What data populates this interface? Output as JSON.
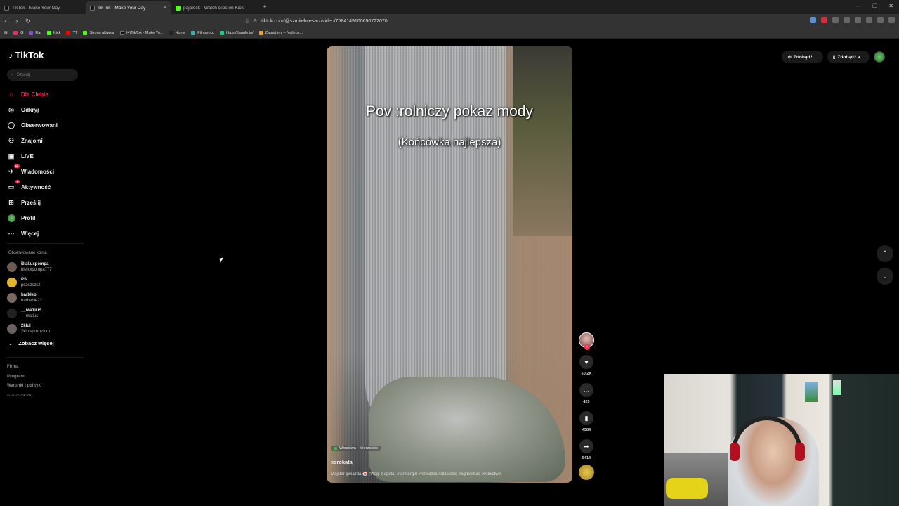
{
  "browser": {
    "tabs": [
      {
        "label": "TikTok - Make Your Day",
        "active": false,
        "icon": "tiktok-icon"
      },
      {
        "label": "TikTok - Make Your Day",
        "active": true,
        "icon": "tiktok-icon"
      },
      {
        "label": "pajalock - Watch clips on Kick",
        "active": false,
        "icon": "kick-icon"
      }
    ],
    "new_tab": "+",
    "url": "tiktok.com/@szmitekcesarz/video/7584149100690722070",
    "bookmarks": [
      "IG",
      "Rat",
      "Kick",
      "YT",
      "Strona główna",
      "(4)TikTok - Make Yo...",
      "Home",
      "Filman.cc",
      "https://tangle.io/",
      "Zagraj.my – Najleps..."
    ]
  },
  "tiktok": {
    "logo": "TikTok",
    "search_placeholder": "Szukaj",
    "nav": [
      {
        "label": "Dla Ciebie",
        "icon": "home-icon",
        "active": true
      },
      {
        "label": "Odkryj",
        "icon": "compass-icon"
      },
      {
        "label": "Obserwowani",
        "icon": "following-icon"
      },
      {
        "label": "Znajomi",
        "icon": "friends-icon"
      },
      {
        "label": "LIVE",
        "icon": "live-icon"
      },
      {
        "label": "Wiadomości",
        "icon": "messages-icon",
        "badge": "99"
      },
      {
        "label": "Aktywność",
        "icon": "activity-icon",
        "badge": "1"
      },
      {
        "label": "Prześlij",
        "icon": "upload-icon"
      },
      {
        "label": "Profil",
        "icon": "profile-icon"
      },
      {
        "label": "Więcej",
        "icon": "more-icon"
      }
    ],
    "followed_title": "Obserwowane konta",
    "followed": [
      {
        "name": "Blakuxpompa",
        "handle": "blejkxpompa777"
      },
      {
        "name": "PS",
        "handle": "pszszszsz"
      },
      {
        "name": "barbleb",
        "handle": "barbebie22"
      },
      {
        "name": "__MATIUS",
        "handle": "__matius"
      },
      {
        "name": "2kłul",
        "handle": "2klulspokoziom"
      }
    ],
    "see_more": "Zobacz więcej",
    "footer": [
      "Firma",
      "Program",
      "Warunki i polityki"
    ],
    "copyright": "© 2026 TikTok",
    "top_right": [
      "Zdobądź ...",
      "Zdobądź a..."
    ]
  },
  "video": {
    "caption_main": "Pov :rolniczy pokaz mody",
    "caption_sub": "(Końcówka najlepsza)",
    "location": "Włostowa - Mierzosów",
    "author": "xsrokata",
    "description": "Majster gwiazda 🤡 (Vlogi z opola) #farmergirl #rolniczka #dlaciebie #agriculture #rolnictwo",
    "likes": "60.2K",
    "comments": "429",
    "saves": "4384",
    "shares": "5414"
  }
}
